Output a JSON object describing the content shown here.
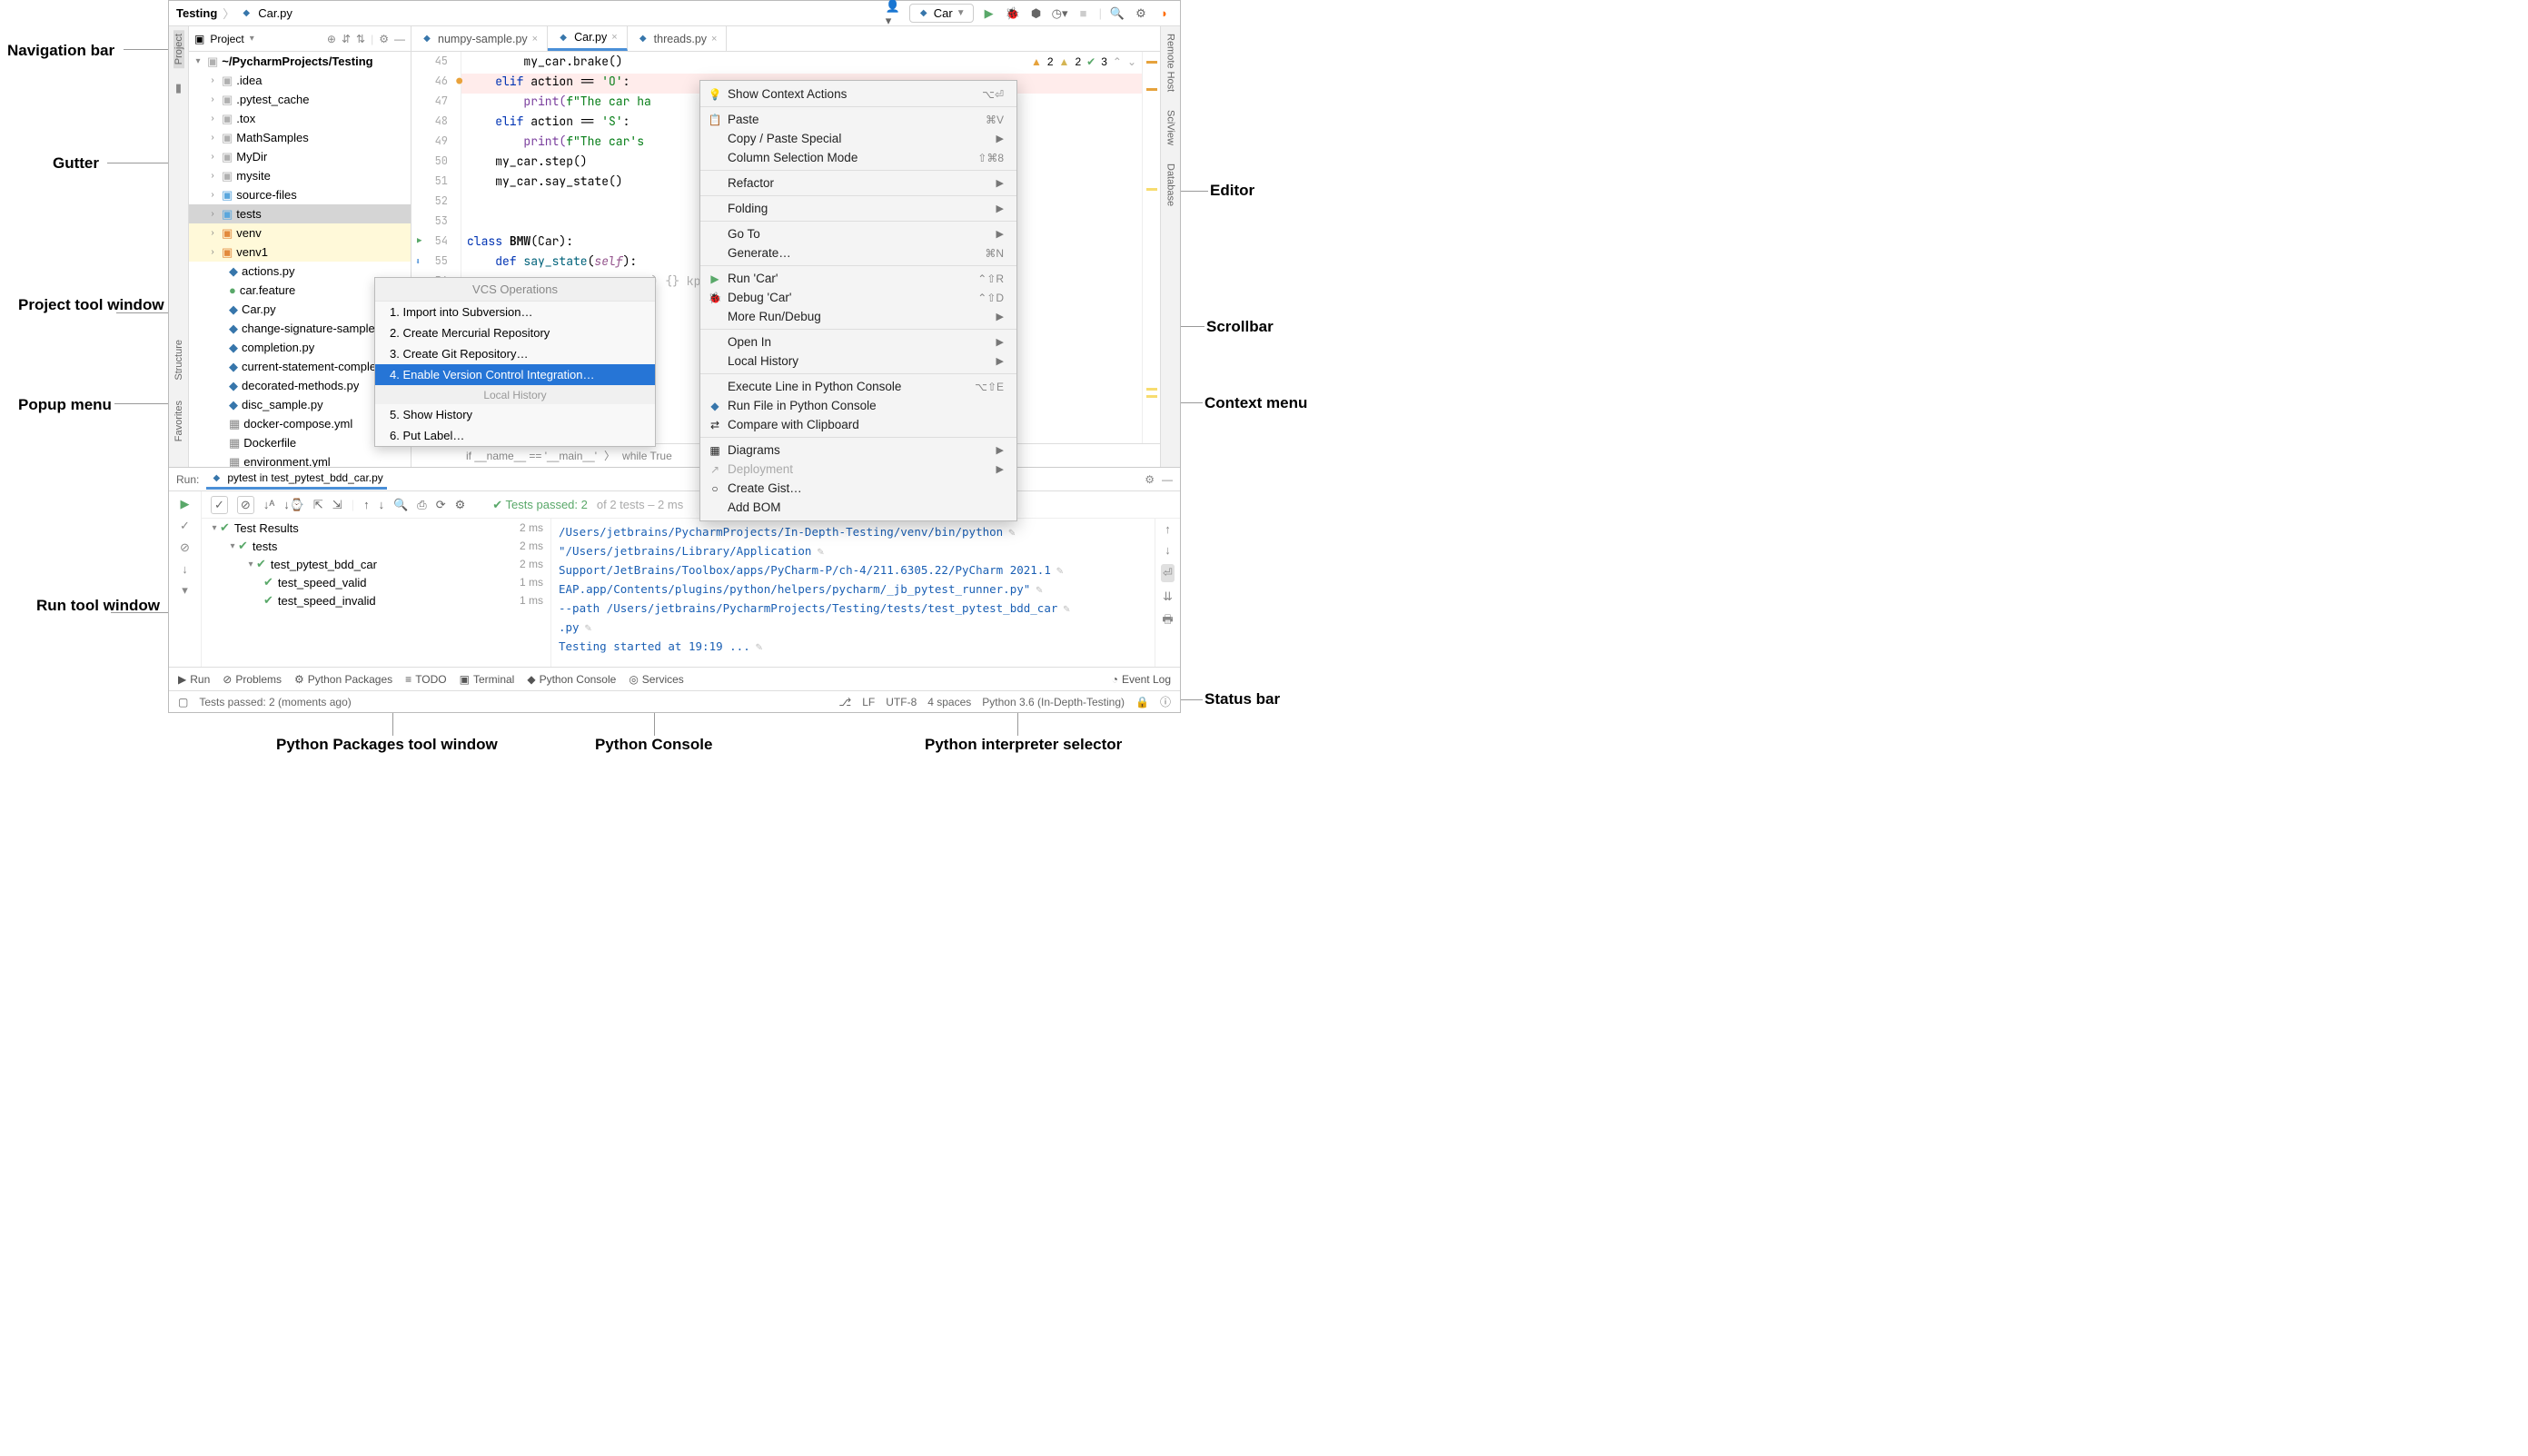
{
  "annotations": {
    "nav": "Navigation bar",
    "gutter": "Gutter",
    "project": "Project tool window",
    "popup": "Popup menu",
    "runwin": "Run tool window",
    "editor": "Editor",
    "scrollbar": "Scrollbar",
    "context": "Context menu",
    "statusbar": "Status bar",
    "pypkg": "Python Packages tool window",
    "pyconsole": "Python Console",
    "pyinterp": "Python interpreter selector"
  },
  "breadcrumb": {
    "a": "Testing",
    "b": "Car.py"
  },
  "run_config": "Car",
  "project_header": "Project",
  "tree": {
    "root": "~/PycharmProjects/Testing",
    "items": [
      {
        "l": ".idea",
        "icon": "folder"
      },
      {
        "l": ".pytest_cache",
        "icon": "folder"
      },
      {
        "l": ".tox",
        "icon": "folder"
      },
      {
        "l": "MathSamples",
        "icon": "folder"
      },
      {
        "l": "MyDir",
        "icon": "folder"
      },
      {
        "l": "mysite",
        "icon": "folder"
      },
      {
        "l": "source-files",
        "icon": "folder-blue"
      },
      {
        "l": "tests",
        "icon": "folder-blue",
        "sel": true
      },
      {
        "l": "venv",
        "icon": "folder-orange",
        "hl": true
      },
      {
        "l": "venv1",
        "icon": "folder-orange",
        "hl": true
      },
      {
        "l": "actions.py",
        "icon": "py",
        "leaf": true
      },
      {
        "l": "car.feature",
        "icon": "green",
        "leaf": true
      },
      {
        "l": "Car.py",
        "icon": "py",
        "leaf": true
      },
      {
        "l": "change-signature-sample.py",
        "icon": "py",
        "leaf": true
      },
      {
        "l": "completion.py",
        "icon": "py",
        "leaf": true
      },
      {
        "l": "current-statement-completion.py",
        "icon": "py",
        "leaf": true
      },
      {
        "l": "decorated-methods.py",
        "icon": "py",
        "leaf": true
      },
      {
        "l": "disc_sample.py",
        "icon": "py",
        "leaf": true
      },
      {
        "l": "docker-compose.yml",
        "icon": "gray",
        "leaf": true
      },
      {
        "l": "Dockerfile",
        "icon": "gray",
        "leaf": true
      },
      {
        "l": "environment.yml",
        "icon": "gray",
        "leaf": true
      }
    ]
  },
  "tabs": [
    {
      "l": "numpy-sample.py"
    },
    {
      "l": "Car.py",
      "active": true
    },
    {
      "l": "threads.py"
    }
  ],
  "gutter_lines": [
    "45",
    "46",
    "47",
    "48",
    "49",
    "50",
    "51",
    "52",
    "53",
    "54",
    "55",
    "56"
  ],
  "code45": "        my_car.brake()",
  "code46a": "    elif",
  "code46b": " action == ",
  "code46c": "'O'",
  "code46d": ":",
  "code47a": "        print(",
  "code47b": "f\"The car ha",
  "code48a": "    elif",
  "code48b": " action == ",
  "code48c": "'S'",
  "code48d": ":",
  "code49a": "        print(",
  "code49b": "f\"The car's                       kph\"",
  "code49c": ")",
  "code50": "    my_car.step()",
  "code51": "    my_car.say_state()",
  "code54a": "class ",
  "code54b": "BMW",
  "code54c": "(Car):",
  "code55a": "    def ",
  "code55b": "say_state",
  "code55c": "(",
  "code55d": "self",
  "code55e": "):",
  "code56a": "                          ) {} kp",
  "inspections": {
    "warn1": "2",
    "warn2": "2",
    "ok": "3"
  },
  "editor_breadcrumb_a": "if __name__ == '__main__'",
  "editor_breadcrumb_b": "while True",
  "popup": {
    "header": "VCS Operations",
    "items": [
      {
        "l": "1. Import into Subversion…"
      },
      {
        "l": "2. Create Mercurial Repository"
      },
      {
        "l": "3. Create Git Repository…"
      },
      {
        "l": "4. Enable Version Control Integration…",
        "sel": true
      }
    ],
    "sep": "Local History",
    "items2": [
      {
        "l": "5. Show History"
      },
      {
        "l": "6. Put Label…"
      }
    ]
  },
  "context": [
    {
      "l": "Show Context Actions",
      "sc": "⌥⏎",
      "icon": "💡"
    },
    {
      "sep": true
    },
    {
      "l": "Paste",
      "sc": "⌘V",
      "icon": "📋"
    },
    {
      "l": "Copy / Paste Special",
      "sub": true
    },
    {
      "l": "Column Selection Mode",
      "sc": "⇧⌘8"
    },
    {
      "sep": true
    },
    {
      "l": "Refactor",
      "sub": true
    },
    {
      "sep": true
    },
    {
      "l": "Folding",
      "sub": true
    },
    {
      "sep": true
    },
    {
      "l": "Go To",
      "sub": true
    },
    {
      "l": "Generate…",
      "sc": "⌘N"
    },
    {
      "sep": true
    },
    {
      "l": "Run 'Car'",
      "sc": "⌃⇧R",
      "icon": "▶",
      "iconcolor": "#59a869"
    },
    {
      "l": "Debug 'Car'",
      "sc": "⌃⇧D",
      "icon": "🐞",
      "iconcolor": "#59a869"
    },
    {
      "l": "More Run/Debug",
      "sub": true
    },
    {
      "sep": true
    },
    {
      "l": "Open In",
      "sub": true
    },
    {
      "l": "Local History",
      "sub": true
    },
    {
      "sep": true
    },
    {
      "l": "Execute Line in Python Console",
      "sc": "⌥⇧E"
    },
    {
      "l": "Run File in Python Console",
      "icon": "◆",
      "iconcolor": "#3776ab"
    },
    {
      "l": "Compare with Clipboard",
      "icon": "⇄"
    },
    {
      "sep": true
    },
    {
      "l": "Diagrams",
      "sub": true,
      "icon": "▦"
    },
    {
      "l": "Deployment",
      "sub": true,
      "disabled": true,
      "icon": "↗"
    },
    {
      "l": "Create Gist…",
      "icon": "○"
    },
    {
      "l": "Add BOM"
    }
  ],
  "right_stripe": [
    "Remote Host",
    "SciView",
    "Database"
  ],
  "run_tab_label": "Run:",
  "run_tab_name": "pytest in test_pytest_bdd_car.py",
  "tests_passed_line": "Tests passed: 2",
  "tests_passed_suffix": " of 2 tests – 2 ms",
  "test_tree": [
    {
      "l": "Test Results",
      "t": "2 ms",
      "depth": 0,
      "exp": "▾"
    },
    {
      "l": "tests",
      "t": "2 ms",
      "depth": 1,
      "exp": "▾"
    },
    {
      "l": "test_pytest_bdd_car",
      "t": "2 ms",
      "depth": 2,
      "exp": "▾"
    },
    {
      "l": "test_speed_valid",
      "t": "1 ms",
      "depth": 3
    },
    {
      "l": "test_speed_invalid",
      "t": "1 ms",
      "depth": 3
    }
  ],
  "console": [
    "/Users/jetbrains/PycharmProjects/In-Depth-Testing/venv/bin/python",
    "\"/Users/jetbrains/Library/Application",
    "Support/JetBrains/Toolbox/apps/PyCharm-P/ch-4/211.6305.22/PyCharm 2021.1",
    "EAP.app/Contents/plugins/python/helpers/pycharm/_jb_pytest_runner.py\"",
    "--path /Users/jetbrains/PycharmProjects/Testing/tests/test_pytest_bdd_car",
    ".py",
    "Testing started at 19:19 ..."
  ],
  "bottom": [
    {
      "l": "Run",
      "icon": "▶"
    },
    {
      "l": "Problems",
      "icon": "⊘"
    },
    {
      "l": "Python Packages",
      "icon": "⚙"
    },
    {
      "l": "TODO",
      "icon": "≡"
    },
    {
      "l": "Terminal",
      "icon": "▣"
    },
    {
      "l": "Python Console",
      "icon": "◆"
    },
    {
      "l": "Services",
      "icon": "◎"
    }
  ],
  "event_log": "Event Log",
  "status": {
    "msg": "Tests passed: 2 (moments ago)",
    "lf": "LF",
    "enc": "UTF-8",
    "indent": "4 spaces",
    "interp": "Python 3.6 (In-Depth-Testing)"
  },
  "left_stripe": [
    "Project"
  ],
  "left_stripe_bottom": [
    "Structure",
    "Favorites"
  ]
}
